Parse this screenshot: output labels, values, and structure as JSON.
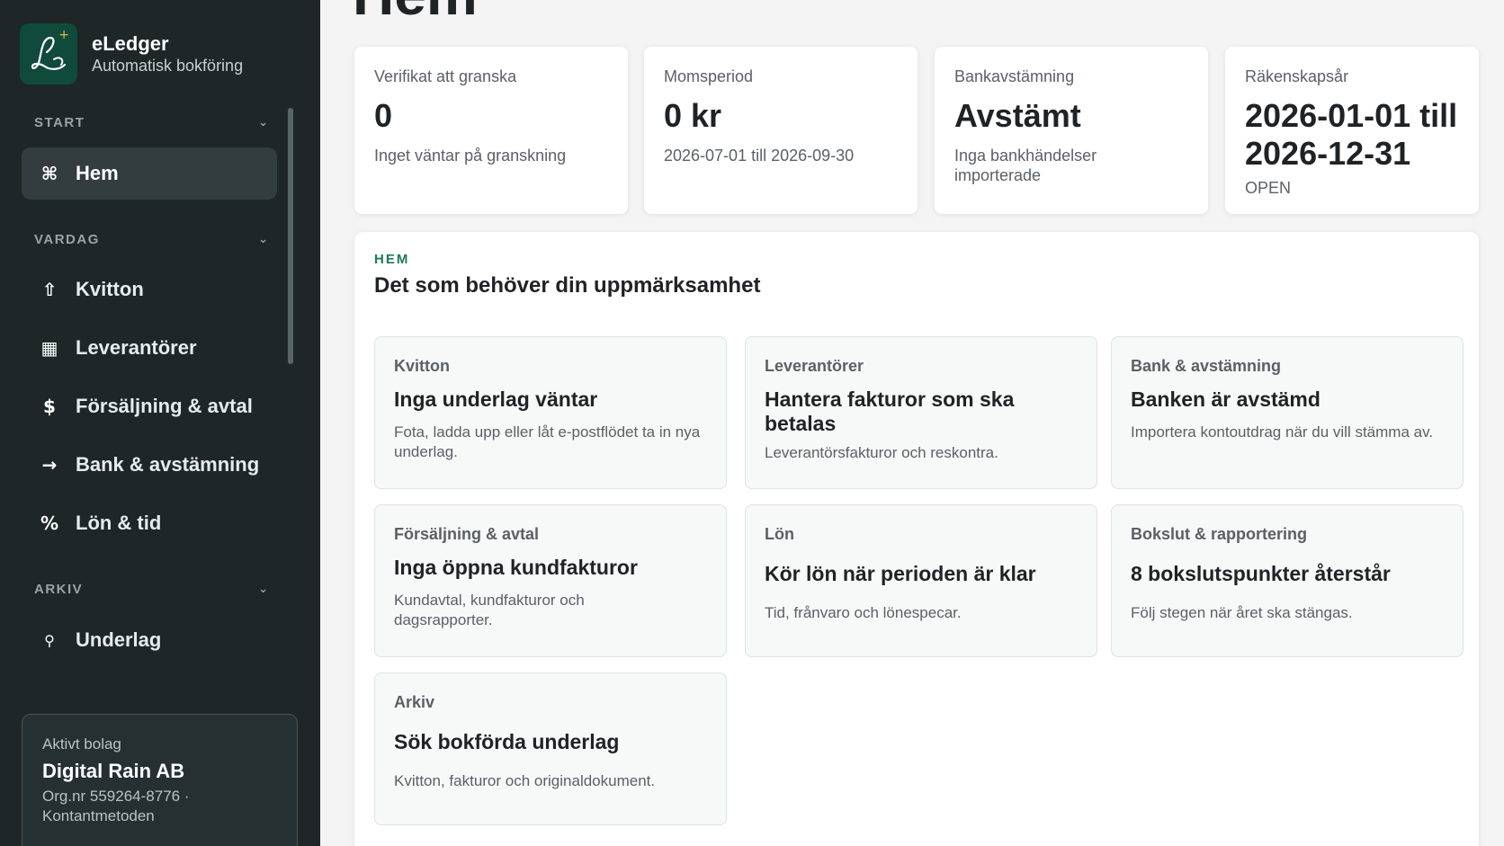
{
  "brand": {
    "name": "eLedger",
    "subtitle": "Automatisk bokföring"
  },
  "sidebar": {
    "sections": [
      {
        "label": "START"
      },
      {
        "label": "VARDAG"
      },
      {
        "label": "ARKIV"
      }
    ],
    "items": [
      {
        "label": "Hem",
        "icon": "command-icon"
      },
      {
        "label": "Kvitton",
        "icon": "upload-icon"
      },
      {
        "label": "Leverantörer",
        "icon": "grid-icon"
      },
      {
        "label": "Försäljning & avtal",
        "icon": "dollar-icon"
      },
      {
        "label": "Bank & avstämning",
        "icon": "arrow-right-icon"
      },
      {
        "label": "Lön & tid",
        "icon": "percent-icon"
      },
      {
        "label": "Underlag",
        "icon": "search-icon"
      }
    ]
  },
  "company": {
    "label": "Aktivt bolag",
    "name": "Digital Rain AB",
    "org": "Org.nr 559264-8776 · Kontantmetoden"
  },
  "page": {
    "title": "Hem"
  },
  "stats": [
    {
      "label": "Verifikat att granska",
      "value": "0",
      "sub": "Inget väntar på granskning"
    },
    {
      "label": "Momsperiod",
      "value": "0 kr",
      "sub": "2026-07-01 till 2026-09-30"
    },
    {
      "label": "Bankavstämning",
      "value": "Avstämt",
      "sub": "Inga bankhändelser importerade"
    },
    {
      "label": "Räkenskapsår",
      "value": "2026-01-01 till 2026-12-31",
      "sub": "OPEN"
    }
  ],
  "panel": {
    "eyebrow": "HEM",
    "title": "Det som behöver din uppmärksamhet",
    "cards": [
      {
        "kicker": "Kvitton",
        "title": "Inga underlag väntar",
        "desc": "Fota, ladda upp eller låt e-postflödet ta in nya underlag."
      },
      {
        "kicker": "Leverantörer",
        "title": "Hantera fakturor som ska betalas",
        "desc": "Leverantörsfakturor och reskontra."
      },
      {
        "kicker": "Bank & avstämning",
        "title": "Banken är avstämd",
        "desc": "Importera kontoutdrag när du vill stämma av."
      },
      {
        "kicker": "Försäljning & avtal",
        "title": "Inga öppna kundfakturor",
        "desc": "Kundavtal, kundfakturor och dagsrapporter."
      },
      {
        "kicker": "Lön",
        "title": "Kör lön när perioden är klar",
        "desc": "Tid, frånvaro och lönespecar."
      },
      {
        "kicker": "Bokslut & rapportering",
        "title": "8 bokslutspunkter återstår",
        "desc": "Följ stegen när året ska stängas."
      },
      {
        "kicker": "Arkiv",
        "title": "Sök bokförda underlag",
        "desc": "Kvitton, fakturor och originaldokument."
      }
    ]
  },
  "colors": {
    "sidebar": "#1e2628",
    "accent": "#1f7a55",
    "logo_bg": "#0f4a3a"
  }
}
